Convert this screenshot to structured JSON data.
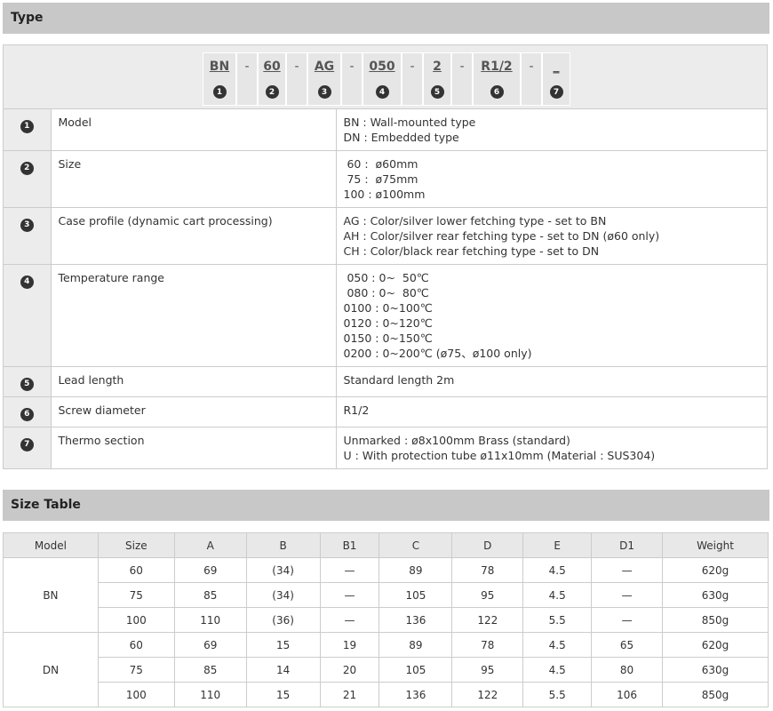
{
  "type_section": {
    "title": "Type"
  },
  "code": [
    {
      "code": "BN",
      "num": "1",
      "sep": false
    },
    {
      "code": "-",
      "num": "",
      "sep": true
    },
    {
      "code": "60",
      "num": "2",
      "sep": false
    },
    {
      "code": "-",
      "num": "",
      "sep": true
    },
    {
      "code": "AG",
      "num": "3",
      "sep": false
    },
    {
      "code": "-",
      "num": "",
      "sep": true
    },
    {
      "code": "050",
      "num": "4",
      "sep": false
    },
    {
      "code": "-",
      "num": "",
      "sep": true
    },
    {
      "code": "2",
      "num": "5",
      "sep": false
    },
    {
      "code": "-",
      "num": "",
      "sep": true
    },
    {
      "code": "R1/2",
      "num": "6",
      "sep": false
    },
    {
      "code": "-",
      "num": "",
      "sep": true
    },
    {
      "code": "_",
      "num": "7",
      "sep": false
    }
  ],
  "type_rows": [
    {
      "num": "1",
      "label": "Model",
      "values": [
        "BN : Wall-mounted type",
        "DN : Embedded type"
      ]
    },
    {
      "num": "2",
      "label": "Size",
      "values": [
        " 60 :  ø60mm",
        " 75 :  ø75mm",
        "100 : ø100mm"
      ]
    },
    {
      "num": "3",
      "label": "Case profile (dynamic cart processing)",
      "values": [
        "AG : Color/silver lower fetching type - set to BN",
        "AH : Color/silver rear fetching type - set to DN (ø60 only)",
        "CH : Color/black rear fetching type - set to DN"
      ]
    },
    {
      "num": "4",
      "label": "Temperature range",
      "values": [
        " 050 : 0~  50℃",
        " 080 : 0~  80℃",
        "0100 : 0~100℃",
        "0120 : 0~120℃",
        "0150 : 0~150℃",
        "0200 : 0~200℃ (ø75、ø100 only)"
      ]
    },
    {
      "num": "5",
      "label": "Lead length",
      "values": [
        "Standard length 2m"
      ]
    },
    {
      "num": "6",
      "label": "Screw diameter",
      "values": [
        "R1/2"
      ]
    },
    {
      "num": "7",
      "label": "Thermo section",
      "values": [
        "Unmarked : ø8x100mm Brass (standard)",
        "U : With protection tube ø11x10mm (Material : SUS304)"
      ]
    }
  ],
  "size_section": {
    "title": "Size Table"
  },
  "size_table": {
    "headers": [
      "Model",
      "Size",
      "A",
      "B",
      "B1",
      "C",
      "D",
      "E",
      "D1",
      "Weight"
    ],
    "groups": [
      {
        "model": "BN",
        "rows": [
          [
            "60",
            "69",
            "(34)",
            "—",
            "89",
            "78",
            "4.5",
            "—",
            "620g"
          ],
          [
            "75",
            "85",
            "(34)",
            "—",
            "105",
            "95",
            "4.5",
            "—",
            "630g"
          ],
          [
            "100",
            "110",
            "(36)",
            "—",
            "136",
            "122",
            "5.5",
            "—",
            "850g"
          ]
        ]
      },
      {
        "model": "DN",
        "rows": [
          [
            "60",
            "69",
            "15",
            "19",
            "89",
            "78",
            "4.5",
            "65",
            "620g"
          ],
          [
            "75",
            "85",
            "14",
            "20",
            "105",
            "95",
            "4.5",
            "80",
            "630g"
          ],
          [
            "100",
            "110",
            "15",
            "21",
            "136",
            "122",
            "5.5",
            "106",
            "850g"
          ]
        ]
      }
    ]
  }
}
